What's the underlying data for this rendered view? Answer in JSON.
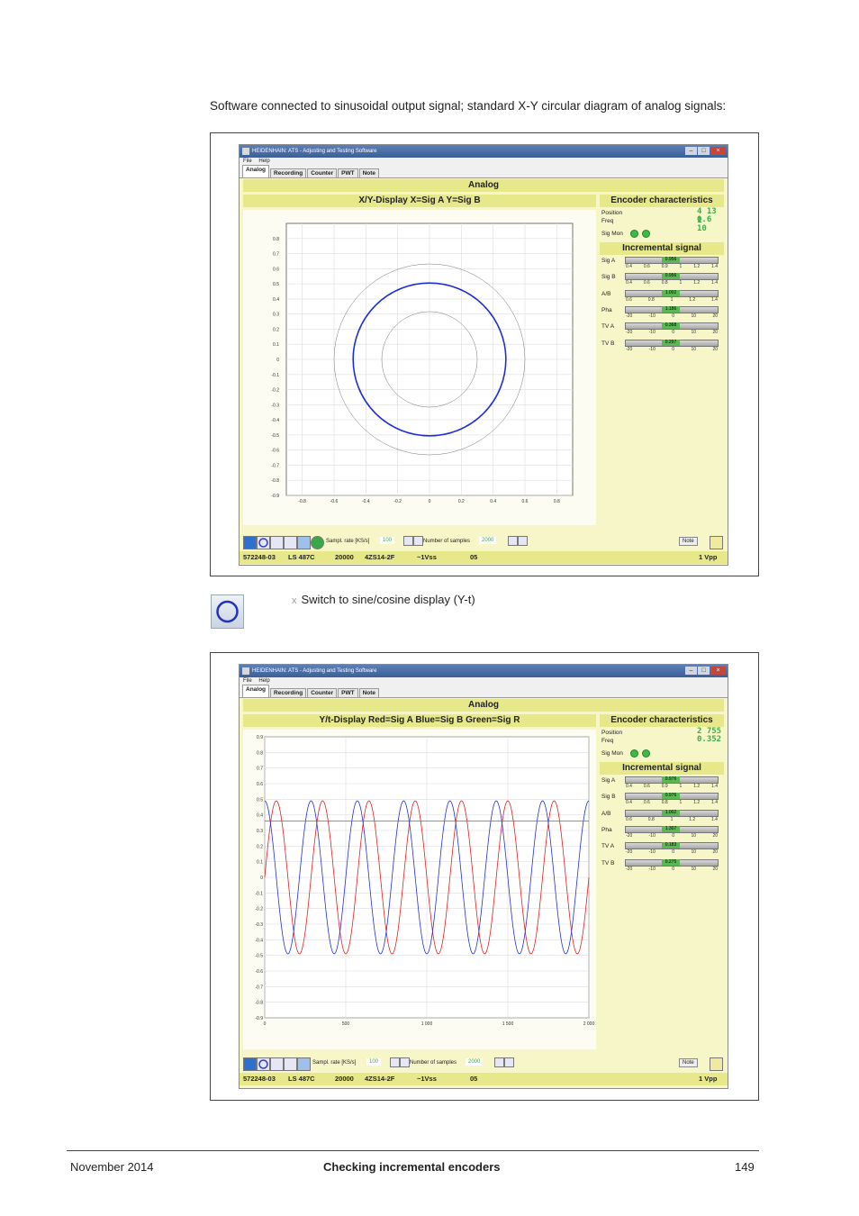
{
  "intro_text": "Software connected to sinusoidal output signal; standard X-Y circular diagram of analog signals:",
  "app": {
    "title": "HEIDENHAIN: ATS - Adjusting and Testing Software",
    "menu": [
      "File",
      "Help"
    ],
    "tabs": [
      "Analog",
      "Recording",
      "Counter",
      "PWT",
      "Note"
    ]
  },
  "screenshot1": {
    "header": "Analog",
    "plot_title": "X/Y-Display X=Sig A Y=Sig B",
    "encoder_title": "Encoder characteristics",
    "position_label": "Position",
    "freq_label": "Freq",
    "position_value": "4 13 1",
    "freq_value": "0.6 10",
    "sigmon_label": "Sig Mon",
    "incremental_title": "Incremental signal",
    "signals": [
      {
        "label": "Sig A",
        "value": "0.956",
        "ticks": [
          "0.4",
          "0.6",
          "0.9",
          "1",
          "1.2",
          "1.4"
        ]
      },
      {
        "label": "Sig B",
        "value": "0.956",
        "ticks": [
          "0.4",
          "0.6",
          "0.8",
          "1",
          "1.2",
          "1.4"
        ]
      },
      {
        "label": "A/B",
        "value": "1.002",
        "ticks": [
          "0.6",
          "0.8",
          "1",
          "1.2",
          "1.4"
        ]
      },
      {
        "label": "Pha",
        "value": "1.186",
        "ticks": [
          "-20",
          "-10",
          "0",
          "10",
          "20"
        ]
      },
      {
        "label": "TV A",
        "value": "0.368",
        "ticks": [
          "-20",
          "-10",
          "0",
          "10",
          "20"
        ]
      },
      {
        "label": "TV B",
        "value": "0.297",
        "ticks": [
          "-20",
          "-10",
          "0",
          "10",
          "20"
        ]
      }
    ],
    "y_ticks": [
      "0.8",
      "0.7",
      "0.6",
      "0.5",
      "0.4",
      "0.3",
      "0.2",
      "0.1",
      "0",
      "-0.1",
      "-0.2",
      "-0.3",
      "-0.4",
      "-0.5",
      "-0.6",
      "-0.7",
      "-0.8",
      "-0.9"
    ],
    "x_ticks": [
      "-0.8",
      "-0.6",
      "-0.4",
      "-0.2",
      "0",
      "0.2",
      "0.4",
      "0.6",
      "0.8"
    ],
    "toolbar": {
      "sample_rate_label": "Sampl. rate [KS/s]",
      "sample_rate_value": "100",
      "samples_label": "Number of samples",
      "samples_value": "2000",
      "note_button": "Note"
    },
    "status": [
      "572248-03",
      "LS 487C",
      "20000",
      "4ZS14-2F",
      "~1Vss",
      "05",
      "1 Vpp"
    ]
  },
  "switch_text": "Switch to sine/cosine display (Y-t)",
  "bullet": "x",
  "screenshot2": {
    "header": "Analog",
    "plot_title": "Y/t-Display Red=Sig A Blue=Sig B Green=Sig R",
    "encoder_title": "Encoder characteristics",
    "position_label": "Position",
    "freq_label": "Freq",
    "position_value": "2 755",
    "freq_value": "0.352",
    "sigmon_label": "Sig Mon",
    "incremental_title": "Incremental signal",
    "signals": [
      {
        "label": "Sig A",
        "value": "0.976",
        "ticks": [
          "0.4",
          "0.6",
          "0.9",
          "1",
          "1.2",
          "1.4"
        ]
      },
      {
        "label": "Sig B",
        "value": "0.976",
        "ticks": [
          "0.4",
          "0.6",
          "0.8",
          "1",
          "1.2",
          "1.4"
        ]
      },
      {
        "label": "A/B",
        "value": "1.002",
        "ticks": [
          "0.6",
          "0.8",
          "1",
          "1.2",
          "1.4"
        ]
      },
      {
        "label": "Pha",
        "value": "1.307",
        "ticks": [
          "-20",
          "-10",
          "0",
          "10",
          "20"
        ]
      },
      {
        "label": "TV A",
        "value": "0.183",
        "ticks": [
          "-20",
          "-10",
          "0",
          "10",
          "20"
        ]
      },
      {
        "label": "TV B",
        "value": "0.275",
        "ticks": [
          "-20",
          "-10",
          "0",
          "10",
          "20"
        ]
      }
    ],
    "y_ticks": [
      "0.9",
      "0.8",
      "0.7",
      "0.6",
      "0.5",
      "0.4",
      "0.3",
      "0.2",
      "0.1",
      "0",
      "-0.1",
      "-0.2",
      "-0.3",
      "-0.4",
      "-0.5",
      "-0.6",
      "-0.7",
      "-0.8",
      "-0.9"
    ],
    "x_ticks": [
      "0",
      "500",
      "1 000",
      "1 500",
      "2 000"
    ],
    "toolbar": {
      "sample_rate_label": "Sampl. rate [KS/s]",
      "sample_rate_value": "100",
      "samples_label": "Number of samples",
      "samples_value": "2000",
      "note_button": "Note"
    },
    "status": [
      "572248-03",
      "LS 487C",
      "20000",
      "4ZS14-2F",
      "~1Vss",
      "05",
      "1 Vpp"
    ]
  },
  "chart_data": [
    {
      "type": "scatter",
      "title": "X/Y-Display X=Sig A Y=Sig B",
      "xlim": [
        -0.9,
        0.9
      ],
      "ylim": [
        -0.9,
        0.9
      ],
      "grid": true,
      "series": [
        {
          "name": "Sig A / Sig B",
          "color": "#1f2fd6",
          "shape": "circle",
          "center": [
            0,
            0
          ],
          "radius": 0.48
        }
      ],
      "reference_circles": [
        0.3,
        0.6
      ]
    },
    {
      "type": "line",
      "title": "Y/t-Display Red=Sig A Blue=Sig B Green=Sig R",
      "xlim": [
        0,
        2000
      ],
      "ylim": [
        -0.9,
        0.9
      ],
      "grid": true,
      "x_ticks": [
        0,
        500,
        1000,
        1500,
        2000
      ],
      "series": [
        {
          "name": "Sig A",
          "color": "#e02020",
          "amplitude": 0.49,
          "cycles": 7,
          "phase_deg": 0
        },
        {
          "name": "Sig B",
          "color": "#2030d8",
          "amplitude": 0.49,
          "cycles": 7,
          "phase_deg": 90
        },
        {
          "name": "Sig R",
          "color": "#20a040",
          "level": 0.36
        }
      ]
    }
  ],
  "footer": {
    "date": "November 2014",
    "title": "Checking incremental encoders",
    "page": "149"
  }
}
